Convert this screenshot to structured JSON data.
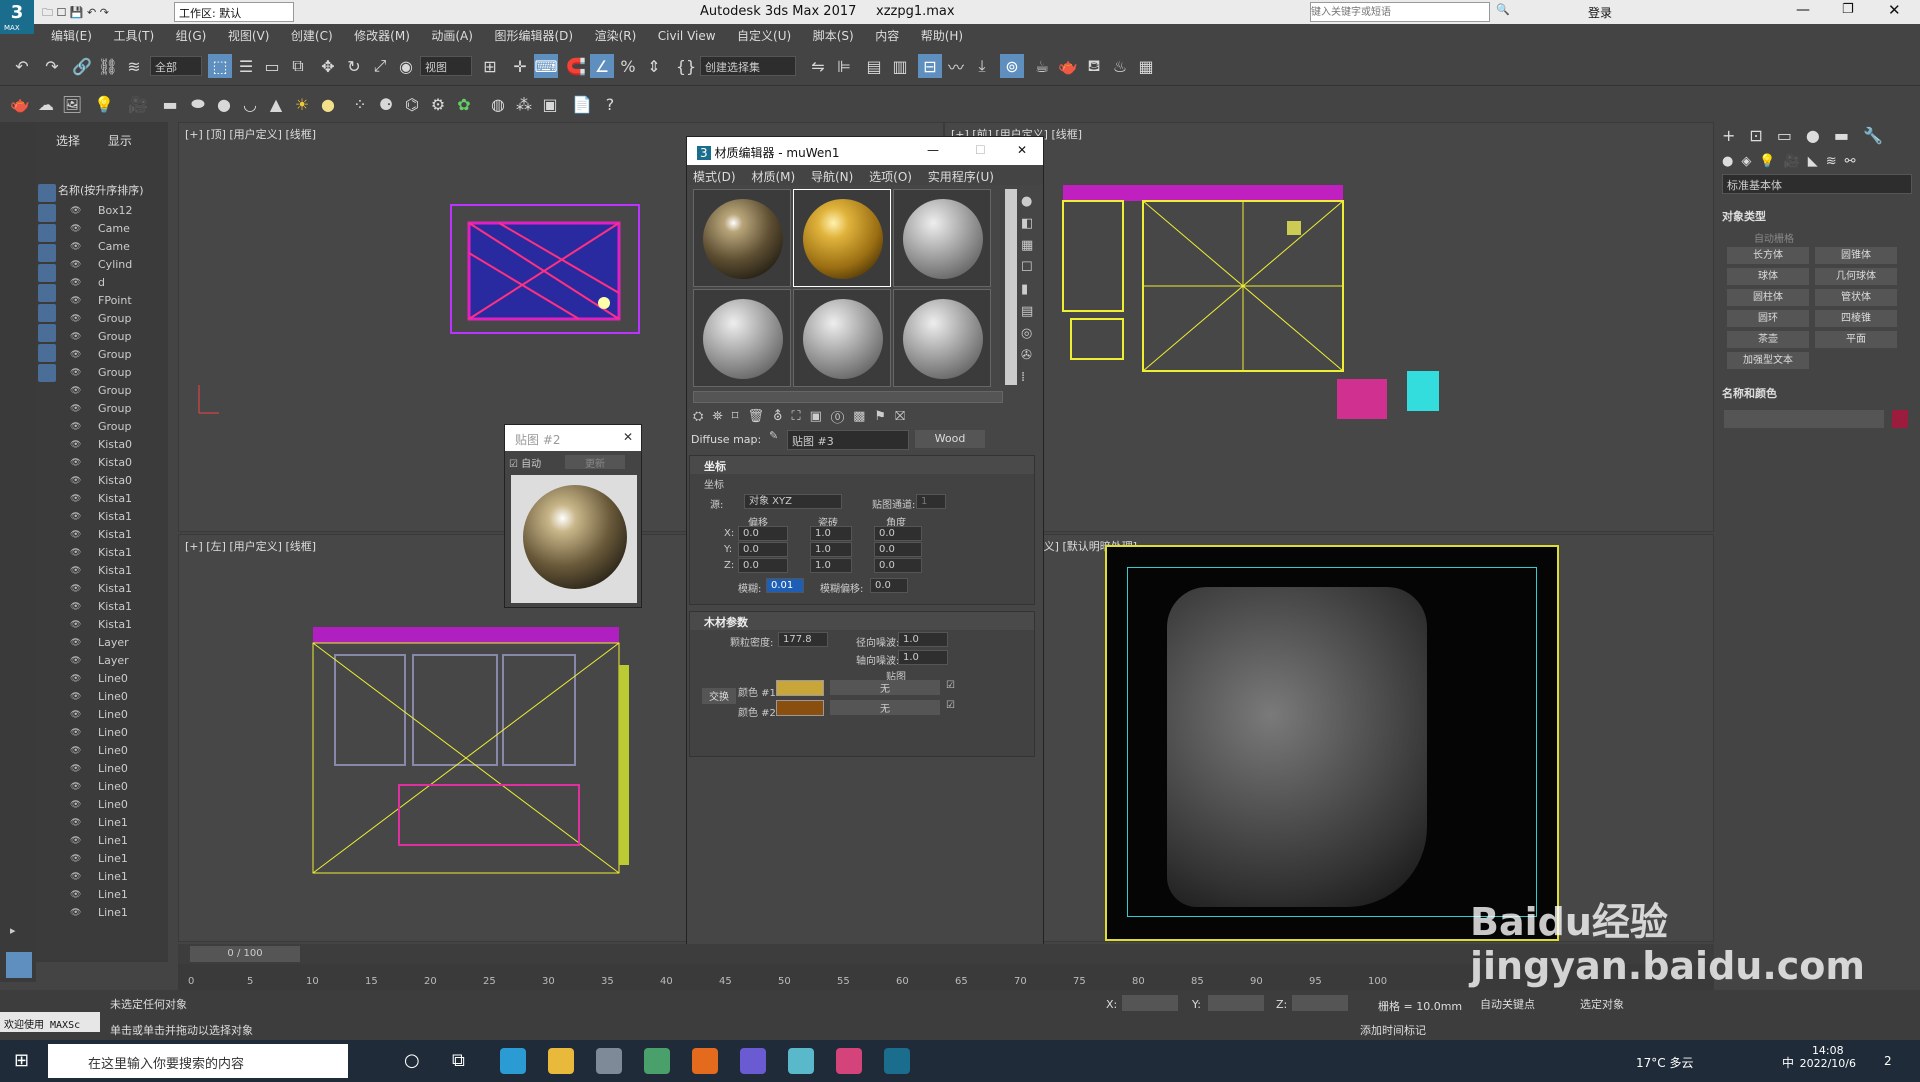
{
  "titlebar": {
    "workspace": "工作区: 默认",
    "title": "Autodesk 3ds Max 2017",
    "file": "xzzpg1.max",
    "search_placeholder": "键入关键字或短语",
    "login": "登录",
    "logo": "MAX"
  },
  "menu": [
    "编辑(E)",
    "工具(T)",
    "组(G)",
    "视图(V)",
    "创建(C)",
    "修改器(M)",
    "动画(A)",
    "图形编辑器(D)",
    "渲染(R)",
    "Civil View",
    "自定义(U)",
    "脚本(S)",
    "内容",
    "帮助(H)"
  ],
  "toolbar": {
    "filter": "全部",
    "view": "视图",
    "selection_set": "创建选择集"
  },
  "explorer": {
    "tab_select": "选择",
    "tab_display": "显示",
    "header": "名称(按升序排序)",
    "items": [
      "Box12",
      "Came",
      "Came",
      "Cylind",
      "d",
      "FPoint",
      "Group",
      "Group",
      "Group",
      "Group",
      "Group",
      "Group",
      "Group",
      "Kista0",
      "Kista0",
      "Kista0",
      "Kista1",
      "Kista1",
      "Kista1",
      "Kista1",
      "Kista1",
      "Kista1",
      "Kista1",
      "Kista1",
      "Layer",
      "Layer",
      "Line0",
      "Line0",
      "Line0",
      "Line0",
      "Line0",
      "Line0",
      "Line0",
      "Line0",
      "Line1",
      "Line1",
      "Line1",
      "Line1",
      "Line1",
      "Line1"
    ]
  },
  "viewports": {
    "top": "[+] [顶] [用户定义] [线框]",
    "front": "[+] [前] [用户定义] [线框]",
    "left": "[+] [左] [用户定义] [线框]",
    "persp": "[+] [透视] [用户定义] [默认明暗处理]"
  },
  "mated": {
    "title": "材质编辑器 - muWen1",
    "menu": [
      "模式(D)",
      "材质(M)",
      "导航(N)",
      "选项(O)",
      "实用程序(U)"
    ],
    "diffuse_label": "Diffuse map:",
    "map_name": "贴图 #3",
    "map_type": "Wood",
    "coords_title": "坐标",
    "coords_sub": "坐标",
    "source_label": "源:",
    "source": "对象 XYZ",
    "channel_label": "贴图通道:",
    "channel": "1",
    "offset": "偏移",
    "tiling": "瓷砖",
    "angle": "角度",
    "rows": [
      {
        "axis": "X:",
        "o": "0.0",
        "t": "1.0",
        "a": "0.0"
      },
      {
        "axis": "Y:",
        "o": "0.0",
        "t": "1.0",
        "a": "0.0"
      },
      {
        "axis": "Z:",
        "o": "0.0",
        "t": "1.0",
        "a": "0.0"
      }
    ],
    "blur_label": "模糊:",
    "blur": "0.01",
    "blur_offset_label": "模糊偏移:",
    "blur_offset": "0.0",
    "wood_title": "木材参数",
    "grain_label": "颗粒密度:",
    "grain": "177.8",
    "radial_label": "径向噪波:",
    "radial": "1.0",
    "axial_label": "轴向噪波:",
    "axial": "1.0",
    "maps_label": "贴图",
    "swap": "交换",
    "color1_label": "颜色 #1",
    "color2_label": "颜色 #2",
    "none": "无",
    "color1": "#c8a63a",
    "color2": "#8a4f0e"
  },
  "map2": {
    "title": "贴图 #2",
    "auto": "自动",
    "update": "更新"
  },
  "cmd": {
    "dropdown": "标准基本体",
    "objtype": "对象类型",
    "autogrid": "自动栅格",
    "buttons": [
      "长方体",
      "圆锥体",
      "球体",
      "几何球体",
      "圆柱体",
      "管状体",
      "圆环",
      "四棱锥",
      "茶壶",
      "平面",
      "加强型文本"
    ],
    "namecolor": "名称和颜色",
    "color": "#9b1c3d"
  },
  "timeline": {
    "frame": "0 / 100",
    "ticks": [
      "0",
      "5",
      "10",
      "15",
      "20",
      "25",
      "30",
      "35",
      "40",
      "45",
      "50",
      "55",
      "60",
      "65",
      "70",
      "75",
      "80",
      "85",
      "90",
      "95",
      "100"
    ]
  },
  "status": {
    "maxscript": "欢迎使用 MAXSc",
    "none_selected": "未选定任何对象",
    "hint": "单击或单击并拖动以选择对象",
    "x": "X:",
    "y": "Y:",
    "z": "Z:",
    "grid": "栅格 = 10.0mm",
    "addtime": "添加时间标记",
    "autokey": "自动关键点",
    "setkey": "选定对象"
  },
  "taskbar": {
    "search": "在这里输入你要搜索的内容",
    "weather": "17°C 多云",
    "ime": "中",
    "time": "14:08",
    "date": "2022/10/6",
    "badge": "2"
  },
  "watermark": "Baidu经验 jingyan.baidu.com"
}
